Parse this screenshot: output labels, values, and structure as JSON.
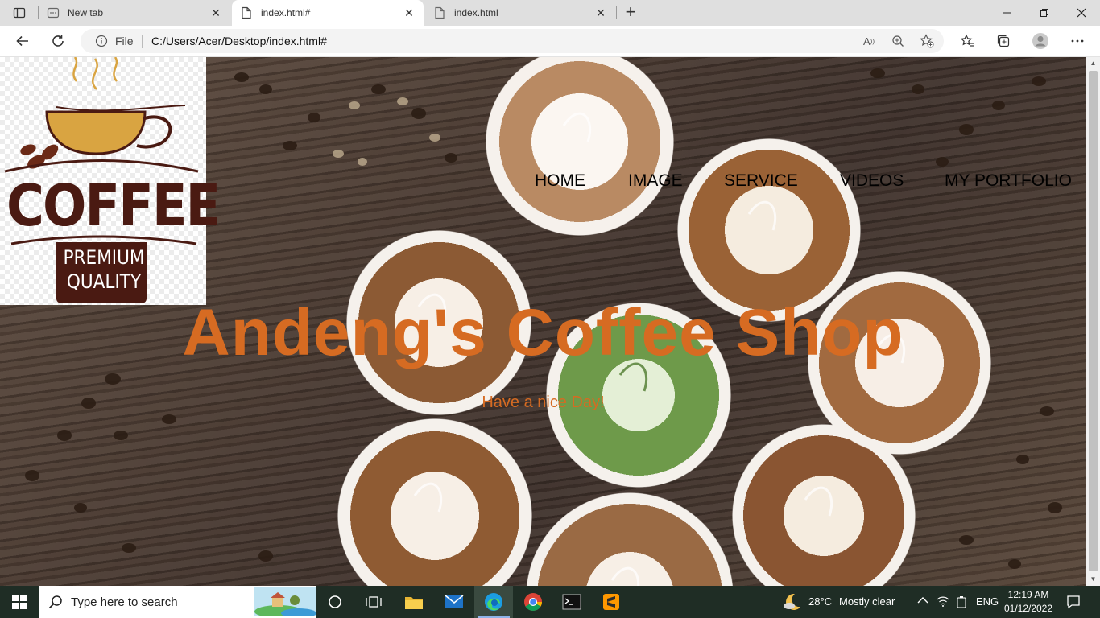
{
  "browser": {
    "tabs": [
      {
        "title": "New tab",
        "icon": "new-tab-page-icon",
        "active": false
      },
      {
        "title": "index.html#",
        "icon": "file-icon",
        "active": true
      },
      {
        "title": "index.html",
        "icon": "file-icon",
        "active": false
      }
    ],
    "address": {
      "scheme_label": "File",
      "url": "C:/Users/Acer/Desktop/index.html#"
    }
  },
  "page": {
    "logo": {
      "word": "COFFEE",
      "line1": "PREMIUM",
      "line2": "QUALITY"
    },
    "nav": [
      "HOME",
      "IMAGE",
      "SERVICE",
      "VIDEOS",
      "MY PORTFOLIO"
    ],
    "title": "Andeng's Coffee Shop",
    "subtitle": "Have a nice Day!",
    "colors": {
      "accent": "#d66b22",
      "logo_brown": "#4a1a12",
      "cup_gold": "#d9a441"
    }
  },
  "taskbar": {
    "search_placeholder": "Type here to search",
    "weather_temp": "28°C",
    "weather_text": "Mostly clear",
    "language": "ENG",
    "time": "12:19 AM",
    "date": "01/12/2022",
    "pinned": [
      "task-view",
      "file-explorer",
      "mail",
      "edge",
      "chrome",
      "terminal",
      "sublime-text"
    ]
  }
}
